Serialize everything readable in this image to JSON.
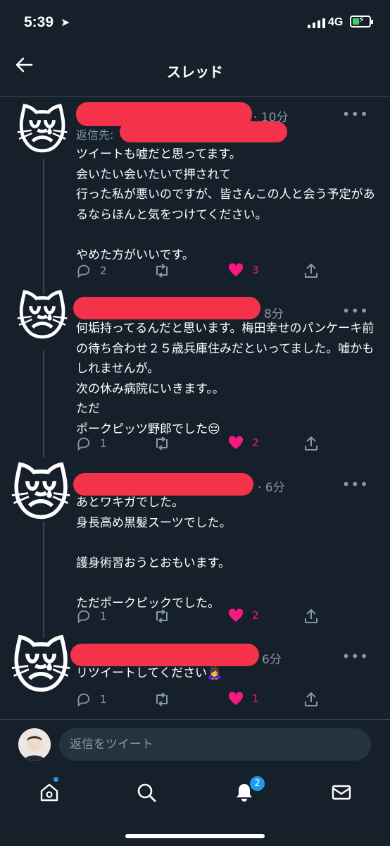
{
  "status_bar": {
    "time": "5:39",
    "network": "4G"
  },
  "header": {
    "title": "スレッド",
    "back_icon": "arrow-left-icon"
  },
  "tweets": [
    {
      "avatar": "crying-cat-face-icon",
      "time": "· 10分",
      "reply_to": "返信先:",
      "text": "ツイートも嘘だと思ってます。\n会いたい会いたいで押されて\n行った私が悪いのですが、皆さんこの人と会う予定があるならほんと気をつけてください。\n\nやめた方がいいです。",
      "replies": "2",
      "retweets": "",
      "likes": "3"
    },
    {
      "avatar": "crying-cat-face-icon",
      "time": "8分",
      "text": "何垢持ってるんだと思います。梅田幸せのパンケーキ前の待ち合わせ２５歳兵庫住みだといってました。嘘かもしれませんが。\n次の休み病院にいきます。。\nただ\nポークピッツ野郎でした😔",
      "replies": "1",
      "retweets": "",
      "likes": "2"
    },
    {
      "avatar": "crying-cat-face-icon",
      "time": "· 6分",
      "text": "あとワキガでした。\n身長高め黒髪スーツでした。\n\n護身術習おうとおもいます。\n\nただポークピックでした。",
      "replies": "1",
      "retweets": "",
      "likes": "2"
    },
    {
      "avatar": "crying-cat-face-icon",
      "time": "6分",
      "text": "リツイートしてください🙇‍♀️",
      "replies": "1",
      "retweets": "",
      "likes": "1"
    }
  ],
  "compose": {
    "placeholder": "返信をツイート"
  },
  "tabbar": {
    "notifications_badge": "2"
  },
  "colors": {
    "background": "#15202b",
    "like": "#f91880",
    "accent": "#1d9bf0",
    "redaction": "#f4324a"
  }
}
